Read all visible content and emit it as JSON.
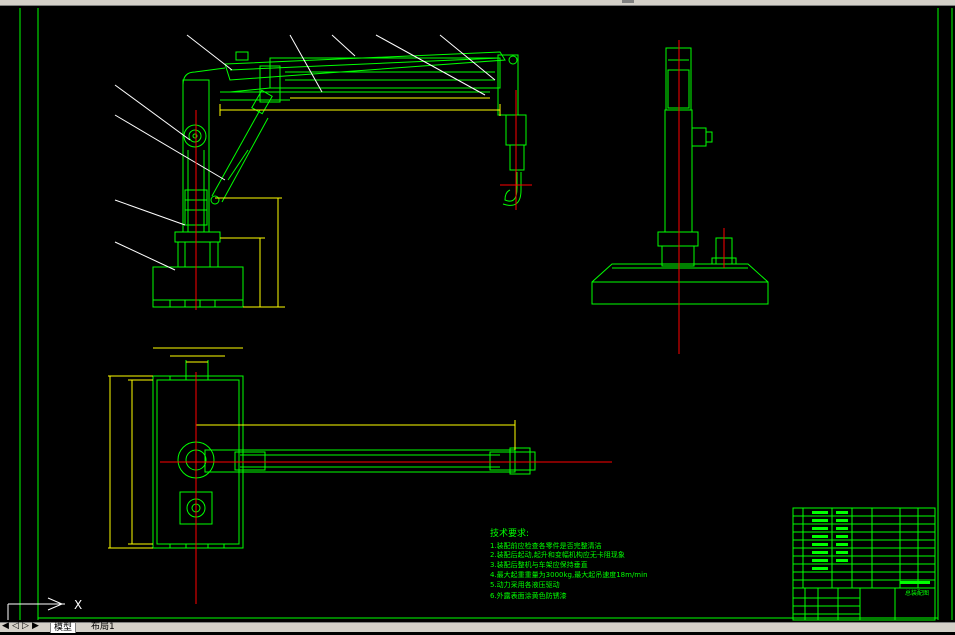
{
  "window": {
    "title": "",
    "layout_tabs": [
      "模型",
      "布局1"
    ],
    "tab_nav_icons": [
      "first-tab-icon",
      "prev-tab-icon",
      "next-tab-icon",
      "last-tab-icon"
    ]
  },
  "drawing": {
    "tech_requirements": {
      "heading": "技术要求:",
      "items": [
        "1.装配前应检查各零件是否完整清洁",
        "2.装配后起动,起升和变幅机构应无卡阻现象",
        "3.装配后整机与车架应保持垂直",
        "4.最大起重重量为3000kg,最大起吊速度18m/min",
        "5.动力采用各液压驱动",
        "6.外露表面涂黄色防锈漆"
      ]
    },
    "title_block": {
      "drawing_name": "总装配图"
    },
    "ucs_label": "X",
    "colors": {
      "background": "#000000",
      "geometry": "#00ff00",
      "dimension": "#ffff00",
      "centerline": "#ff0000",
      "leader": "#ffffff"
    }
  }
}
